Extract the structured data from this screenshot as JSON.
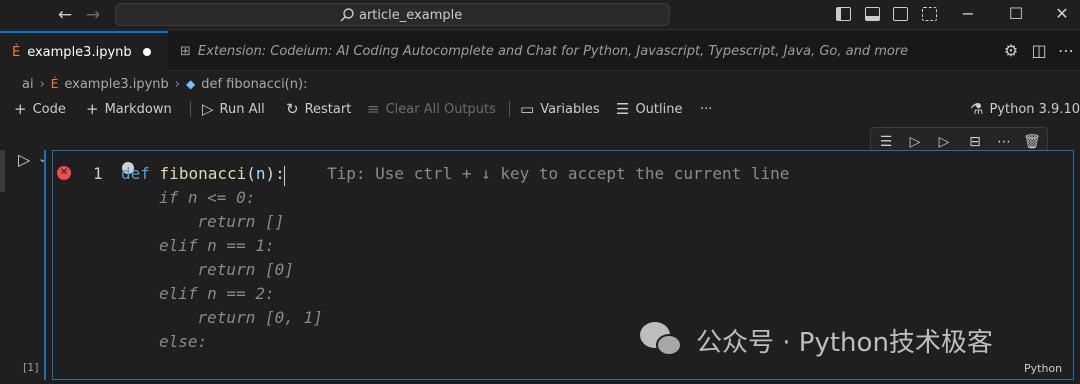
{
  "titlebar": {
    "search_text": "article_example"
  },
  "tabs": {
    "active_label": "example3.ipynb",
    "inactive_label": "Extension: Codeium: AI Coding Autocomplete and Chat for Python, Javascript, Typescript, Java, Go, and more"
  },
  "breadcrumb": {
    "root": "ai",
    "file": "example3.ipynb",
    "symbol": "def fibonacci(n):"
  },
  "toolbar": {
    "code": "Code",
    "markdown": "Markdown",
    "run_all": "Run All",
    "restart": "Restart",
    "clear_all_outputs": "Clear All Outputs",
    "variables": "Variables",
    "outline": "Outline",
    "more": "···",
    "kernel": "Python 3.9.10"
  },
  "cell": {
    "line_number": "1",
    "code": {
      "kw_def": "def",
      "fn_name": "fibonacci",
      "open_paren": "(",
      "param": "n",
      "close_colon": "):"
    },
    "tip": "Tip: Use ctrl + ↓ key to accept the current line",
    "ghost_lines": [
      "if n <= 0:",
      "    return []",
      "elif n == 1:",
      "    return [0]",
      "elif n == 2:",
      "    return [0, 1]",
      "else:"
    ],
    "execution_count": "[1]",
    "language": "Python"
  },
  "watermark": {
    "text": "公众号 · Python技术极客"
  },
  "colors": {
    "accent": "#0078d4",
    "cell_border": "#1f6fb2",
    "error": "#f14c4c",
    "notebook_icon": "#f57d33"
  }
}
